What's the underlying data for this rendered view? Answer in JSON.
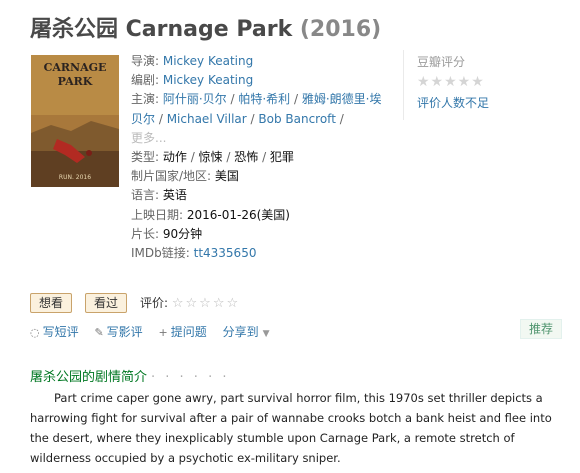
{
  "title": {
    "main": "屠杀公园 Carnage Park",
    "year": "(2016)"
  },
  "poster": {
    "title_line1": "CARNAGE",
    "title_line2": "PARK",
    "date_text": "RUN. 2016"
  },
  "info": {
    "director_label": "导演: ",
    "director": "Mickey Keating",
    "writer_label": "编剧: ",
    "writer": "Mickey Keating",
    "cast_label": "主演: ",
    "cast": [
      "阿什丽·贝尔",
      "帕特·希利",
      "雅姆·朗德里·埃贝尔",
      "Michael Villar",
      "Bob Bancroft"
    ],
    "separator": " / ",
    "more": "更多...",
    "genre_label": "类型: ",
    "genres": [
      "动作",
      "惊悚",
      "恐怖",
      "犯罪"
    ],
    "country_label": "制片国家/地区: ",
    "country": "美国",
    "language_label": "语言: ",
    "language": "英语",
    "release_label": "上映日期: ",
    "release": "2016-01-26(美国)",
    "runtime_label": "片长: ",
    "runtime": "90分钟",
    "imdb_label": "IMDb链接: ",
    "imdb": "tt4335650"
  },
  "rating": {
    "label": "豆瓣评分",
    "stars": "★★★★★",
    "no_rating": "评价人数不足"
  },
  "buttons": {
    "want": "想看",
    "seen": "看过"
  },
  "rate": {
    "label": "评价: ",
    "stars": "☆☆☆☆☆"
  },
  "actions": {
    "short_review": "写短评",
    "review": "写影评",
    "question": "提问题",
    "share": "分享到"
  },
  "recommend": "推荐",
  "synopsis": {
    "heading": "屠杀公园的剧情简介",
    "dots": "· · · · · ·",
    "text": "Part crime caper gone awry, part survival horror film, this 1970s set thriller depicts a harrowing fight for survival after a pair of wannabe crooks botch a bank heist and flee into the desert, where they inexplicably stumble upon Carnage Park, a remote stretch of wilderness occupied by a psychotic ex-military sniper."
  },
  "colors": {
    "link": "#3377aa",
    "green": "#007722",
    "button_bg": "#fbf1de"
  }
}
